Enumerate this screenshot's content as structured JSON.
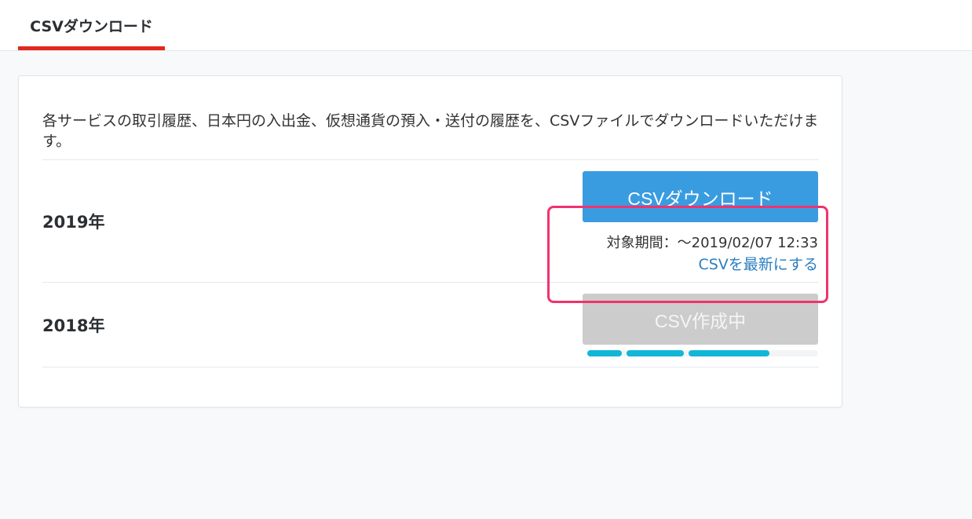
{
  "tabs": [
    {
      "label": "CSVダウンロード",
      "active": true
    }
  ],
  "card": {
    "description": "各サービスの取引履歴、日本円の入出金、仮想通貨の預入・送付の履歴を、CSVファイルでダウンロードいただけます。",
    "rows": [
      {
        "year": "2019年",
        "button_label": "CSVダウンロード",
        "period": "対象期間：〜2019/02/07 12:33",
        "refresh_link": "CSVを最新にする"
      },
      {
        "year": "2018年",
        "button_label": "CSV作成中",
        "progress_segments": [
          {
            "start": 0.0,
            "end": 0.15
          },
          {
            "start": 0.17,
            "end": 0.42
          },
          {
            "start": 0.44,
            "end": 0.79
          }
        ]
      }
    ]
  },
  "colors": {
    "accent_red": "#e3271d",
    "primary_blue": "#3a9ce0",
    "link_blue": "#2a7fc1",
    "progress_cyan": "#12b6d6",
    "highlight_pink": "#f0336e",
    "disabled_gray": "#cccccc"
  }
}
